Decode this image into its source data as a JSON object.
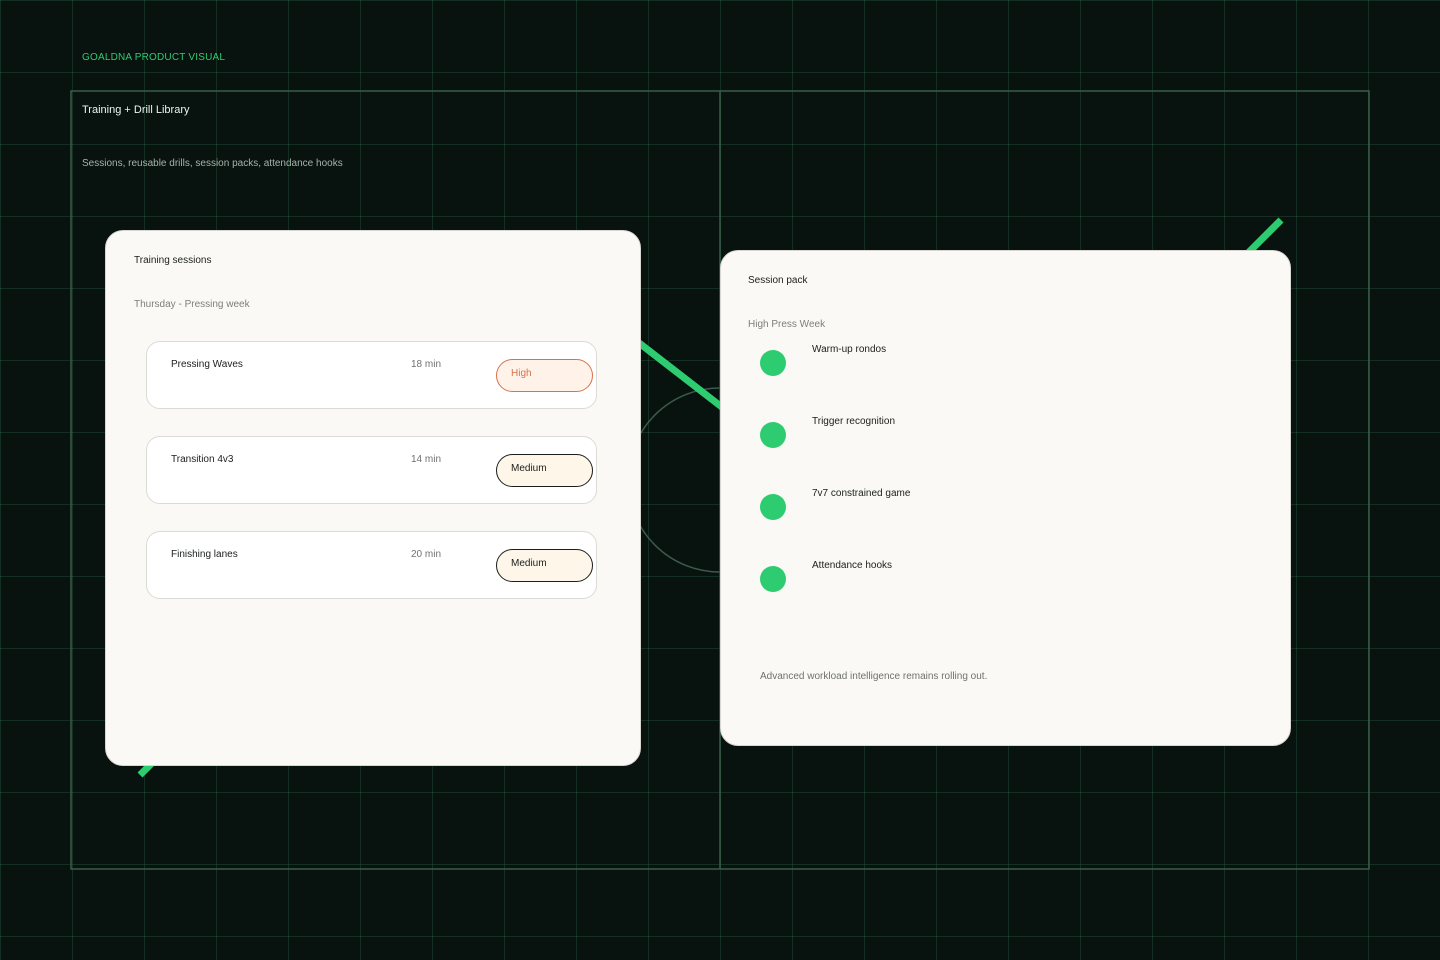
{
  "header": {
    "eyebrow": "GOALDNA PRODUCT VISUAL",
    "title": "Training + Drill Library",
    "subtitle": "Sessions, reusable drills, session packs, attendance hooks"
  },
  "training_sessions": {
    "title": "Training sessions",
    "session_name": "Thursday - Pressing week",
    "drills": [
      {
        "name": "Pressing Waves",
        "duration": "18 min",
        "intensity": "High"
      },
      {
        "name": "Transition 4v3",
        "duration": "14 min",
        "intensity": "Medium"
      },
      {
        "name": "Finishing lanes",
        "duration": "20 min",
        "intensity": "Medium"
      }
    ]
  },
  "session_pack": {
    "title": "Session pack",
    "pack_name": "High Press Week",
    "items": [
      {
        "label": "Warm-up rondos"
      },
      {
        "label": "Trigger recognition"
      },
      {
        "label": "7v7 constrained game"
      },
      {
        "label": "Attendance hooks"
      }
    ],
    "note": "Advanced workload intelligence remains rolling out."
  },
  "colors": {
    "background": "#08120e",
    "grid": "#1f4a35",
    "accent": "#2ecc71",
    "card": "#faf9f5",
    "high": "#d9724a"
  }
}
